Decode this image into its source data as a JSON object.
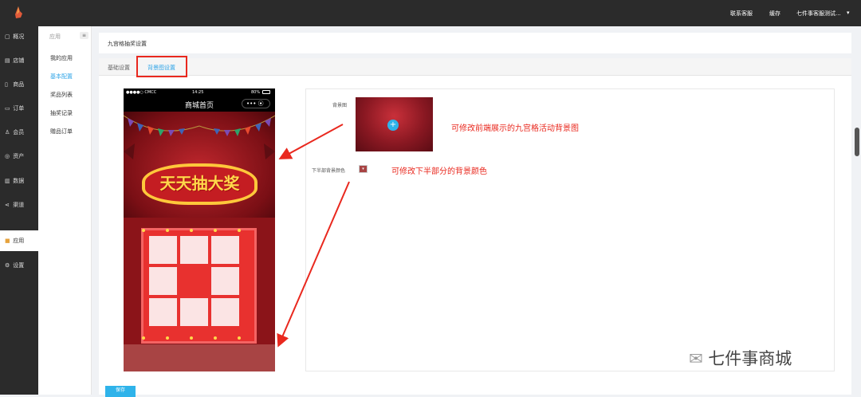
{
  "header": {
    "links": [
      "联系客服",
      "缓存",
      "七件事客服测试..."
    ]
  },
  "sidebar": {
    "items": [
      {
        "label": "概况",
        "icon": "dashboard-icon"
      },
      {
        "label": "店铺",
        "icon": "shop-icon"
      },
      {
        "label": "商品",
        "icon": "goods-icon"
      },
      {
        "label": "订单",
        "icon": "order-icon"
      },
      {
        "label": "会员",
        "icon": "user-icon"
      },
      {
        "label": "资产",
        "icon": "asset-icon"
      },
      {
        "label": "数据",
        "icon": "data-icon"
      },
      {
        "label": "渠道",
        "icon": "channel-icon"
      },
      {
        "label": "应用",
        "icon": "apps-icon",
        "active": true
      },
      {
        "label": "设置",
        "icon": "gear-icon"
      }
    ]
  },
  "subnav": {
    "heading": "应用",
    "items": [
      "我的应用",
      "基本配置",
      "奖品列表",
      "抽奖记录",
      "赠品订单"
    ],
    "active_index": 1
  },
  "page": {
    "title": "九宫格抽奖设置"
  },
  "tabs": {
    "items": [
      "基础设置",
      "背景图设置"
    ],
    "active_index": 1
  },
  "phone_preview": {
    "status_carrier": "●●●●○ CMCC",
    "status_time": "14:25",
    "status_battery": "80%",
    "nav_title": "商城首页",
    "capsule": "•••  ⦿",
    "slogan": "天天抽大奖"
  },
  "settings": {
    "background_image_label": "背景图",
    "upload_symbol": "+",
    "bottom_color_label": "下半部背景颜色",
    "bottom_color": "#a84444",
    "dropdown_symbol": "▾"
  },
  "annotations": {
    "background_note": "可修改前端展示的九宫格活动背景图",
    "color_note": "可修改下半部分的背景颜色"
  },
  "actions": {
    "save_label": "保存"
  },
  "watermark": {
    "text": "七件事商城"
  },
  "colors": {
    "accent": "#2fa4e7",
    "sidebar_bg": "#2b2b2b",
    "annotation_red": "#e9281e",
    "prize_red": "#e8312f"
  }
}
